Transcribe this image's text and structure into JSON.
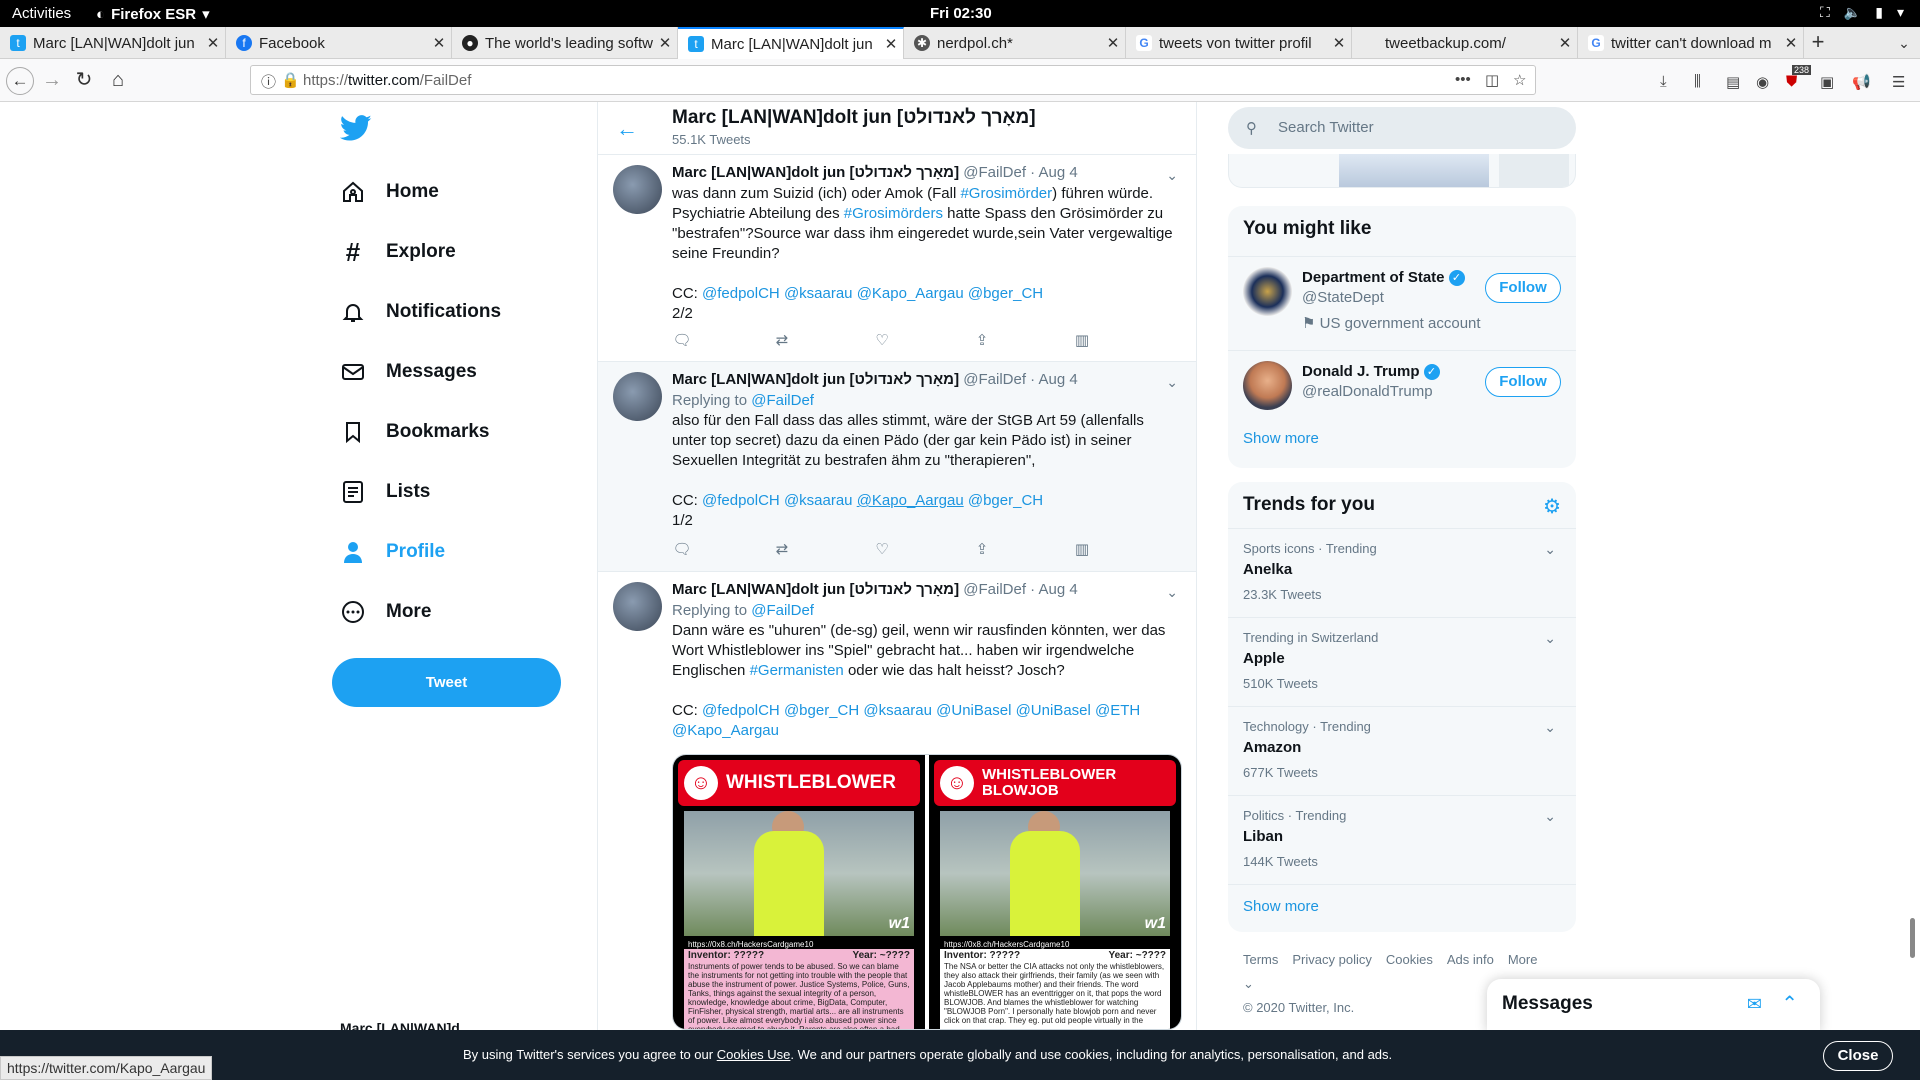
{
  "system": {
    "activities": "Activities",
    "app": "Firefox ESR",
    "clock": "Fri 02:30"
  },
  "tabs": [
    {
      "label": "Marc [LAN|WAN]dolt jun",
      "icon": "twitter-icon",
      "color": "#1da1f2"
    },
    {
      "label": "Facebook",
      "icon": "facebook-icon",
      "color": "#1877f2"
    },
    {
      "label": "The world's leading softw",
      "icon": "github-icon",
      "color": "#222222"
    },
    {
      "label": "Marc [LAN|WAN]dolt jun",
      "icon": "twitter-icon",
      "color": "#1da1f2"
    },
    {
      "label": "nerdpol.ch*",
      "icon": "star-icon",
      "color": "#555555"
    },
    {
      "label": "tweets von twitter profil",
      "icon": "google-icon",
      "color": "#4285f4"
    },
    {
      "label": "tweetbackup.com/",
      "icon": "blank-icon",
      "color": "#ffffff"
    },
    {
      "label": "twitter can't download m",
      "icon": "google-icon",
      "color": "#4285f4"
    }
  ],
  "url": {
    "prefix": "https://",
    "domain": "twitter.com",
    "path": "/FailDef"
  },
  "toolbar_badge": "238",
  "sidebar": {
    "items": [
      {
        "label": "Home"
      },
      {
        "label": "Explore"
      },
      {
        "label": "Notifications"
      },
      {
        "label": "Messages"
      },
      {
        "label": "Bookmarks"
      },
      {
        "label": "Lists"
      },
      {
        "label": "Profile"
      },
      {
        "label": "More"
      }
    ],
    "tweet_button": "Tweet",
    "account_name": "Marc [LAN|WAN]d"
  },
  "feed": {
    "title": "Marc [LAN|WAN]dolt jun [מאָרך לאנדולט]",
    "count": "55.1K Tweets",
    "tweets": [
      {
        "name": "Marc [LAN|WAN]dolt jun [מאָרך לאנדולט]",
        "handle": "@FailDef",
        "date": "· Aug 4",
        "l1a": "was dann zum Suizid (ich) oder Amok (Fall ",
        "l1b": "#Grosimörder",
        "l1c": ") führen würde.",
        "l2a": "Psychiatrie Abteilung des ",
        "l2b": "#Grosimörders",
        "l2c": " hatte Spass den Grösimörder zu",
        "l3": "\"bestrafen\"?Source war dass ihm eingeredet wurde,sein Vater vergewaltige",
        "l4": "seine Freundin?",
        "cc": "CC: ",
        "m1": "@fedpolCH",
        "m2": "@ksaarau",
        "m3": "@Kapo_Aargau",
        "m4": "@bger_CH",
        "page": "2/2"
      },
      {
        "name": "Marc [LAN|WAN]dolt jun [מאָרך לאנדולט]",
        "handle": "@FailDef",
        "date": "· Aug 4",
        "reply": "Replying to ",
        "reply_to": "@FailDef",
        "l1": "also für den Fall dass das alles stimmt, wäre der StGB Art 59 (allenfalls",
        "l2": "unter top secret) dazu da einen Pädo (der gar kein Pädo ist) in seiner",
        "l3": "Sexuellen Integrität zu bestrafen ähm zu \"therapieren\",",
        "cc": "CC: ",
        "m1": "@fedpolCH",
        "m2": "@ksaarau",
        "m3": "@Kapo_Aargau",
        "m4": "@bger_CH",
        "page": "1/2"
      },
      {
        "name": "Marc [LAN|WAN]dolt jun [מאָרך לאנדולט]",
        "handle": "@FailDef",
        "date": "· Aug 4",
        "reply": "Replying to ",
        "reply_to": "@FailDef",
        "l1": "Dann wäre es \"uhuren\" (de-sg) geil, wenn wir rausfinden könnten, wer das",
        "l2": "Wort Whistleblower ins \"Spiel\" gebracht hat... haben wir irgendwelche",
        "l3a": "Englischen ",
        "l3b": "#Germanisten",
        "l3c": " oder wie das halt heisst? Josch?",
        "cc": "CC: ",
        "m1": "@fedpolCH",
        "m2": "@bger_CH",
        "m3": "@ksaarau",
        "m4": "@UniBasel",
        "m5": "@UniBasel",
        "m6": "@ETH",
        "m7": "@Kapo_Aargau",
        "card1_title": "WHISTLEBLOWER",
        "card2_title": "WHISTLEBLOWER BLOWJOB",
        "card_url": "https://0x8.ch/HackersCardgame10",
        "card_w": "w1",
        "inventor": "Inventor: ?????",
        "year": "Year: ~????",
        "card1_text": "Instruments of power tends to be abused. So we can blame the instruments for not getting into trouble with the people that abuse the instrument of power. Justice Systems, Police, Guns, Tanks, things against the sexual integrity of a person, knowledge, knowledge about crime, BigData, Computer, FinFisher, physical strength, martial arts... are all instruments of power. Like almost everybody i also abused power since everybody seemed to abuse it. Parents are also often a bad example where kids learn to abuse such",
        "card2_text": "The NSA or better the CIA attacks not only the whistleblowers, they also attack their girlfriends, their family (as we seen with Jacob Applebaums mother) and their friends. The word whistleBLOWER has an eventtrigger on it, that pops the word BLOWJOB. And blames the whistleblower for watching \"BLOWJOB Porn\". I personally hate blowjob porn and never click on that crap. They eg. put old people virtually in the"
      }
    ]
  },
  "right": {
    "search_placeholder": "Search Twitter",
    "who_title": "You might like",
    "who": [
      {
        "name": "Department of State",
        "handle": "@StateDept",
        "label": "US government account",
        "follow": "Follow"
      },
      {
        "name": "Donald J. Trump",
        "handle": "@realDonaldTrump",
        "follow": "Follow"
      }
    ],
    "show_more": "Show more",
    "trends_title": "Trends for you",
    "trends": [
      {
        "context": "Sports icons · Trending",
        "name": "Anelka",
        "count": "23.3K Tweets"
      },
      {
        "context": "Trending in Switzerland",
        "name": "Apple",
        "count": "510K Tweets"
      },
      {
        "context": "Technology · Trending",
        "name": "Amazon",
        "count": "677K Tweets"
      },
      {
        "context": "Politics · Trending",
        "name": "Liban",
        "count": "144K Tweets"
      }
    ],
    "trends_show_more": "Show more",
    "footer": {
      "terms": "Terms",
      "privacy": "Privacy policy",
      "cookies": "Cookies",
      "ads": "Ads info",
      "more": "More",
      "copy": "© 2020 Twitter, Inc."
    }
  },
  "messages_title": "Messages",
  "cookie": {
    "a": "By using Twitter's services you agree to our ",
    "link": "Cookies Use",
    "b": ". We and our partners operate globally and use cookies, including for analytics, personalisation, and ads.",
    "close": "Close"
  },
  "status_url": "https://twitter.com/Kapo_Aargau"
}
